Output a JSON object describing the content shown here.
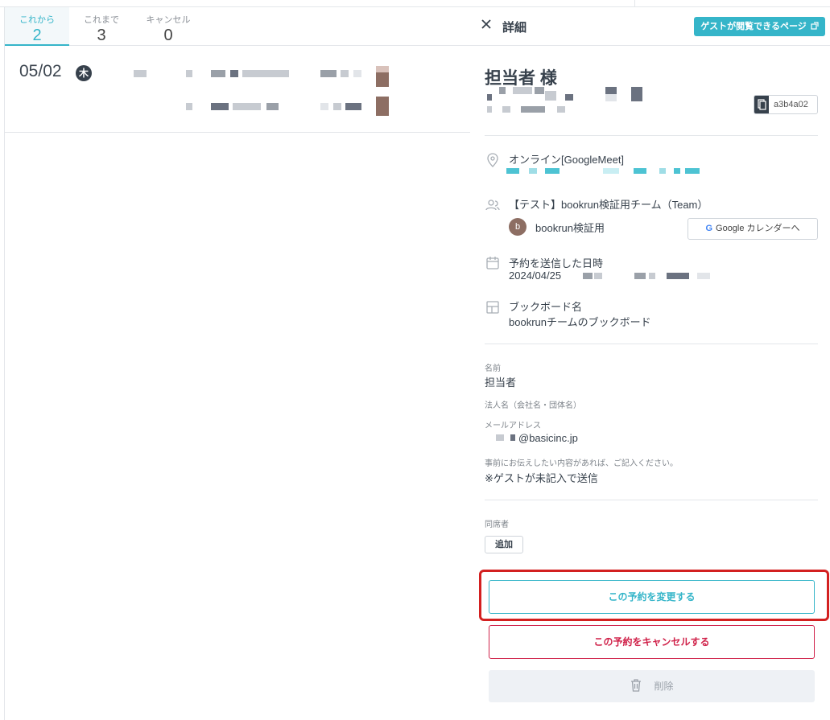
{
  "colors": {
    "accent": "#35b5c9",
    "danger": "#d0224a",
    "dark": "#37414c",
    "highlight": "#d32020"
  },
  "tabs": [
    {
      "label": "これから",
      "count": "2"
    },
    {
      "label": "これまで",
      "count": "3"
    },
    {
      "label": "キャンセル",
      "count": "0"
    }
  ],
  "list": {
    "date": "05/02",
    "weekday": "木"
  },
  "detail": {
    "header_title": "詳細",
    "guest_page_button": "ゲストが閲覧できるページ",
    "name_title": "担当者 様",
    "booking_id": "a3b4a02",
    "location_label": "オンライン[GoogleMeet]",
    "team_label": "【テスト】bookrun検証用チーム（Team）",
    "member_initial": "b",
    "member_name": "bookrun検証用",
    "gcal_button": "Google カレンダーへ",
    "sent_label": "予約を送信した日時",
    "sent_value": "2024/04/25",
    "board_label": "ブックボード名",
    "board_value": "bookrunチームのブックボード"
  },
  "form": {
    "name_label": "名前",
    "name_value": "担当者",
    "company_label": "法人名（会社名・団体名）",
    "email_label": "メールアドレス",
    "email_value": "@basicinc.jp",
    "message_label": "事前にお伝えしたい内容があれば、ご記入ください。",
    "message_value": "※ゲストが未記入で送信"
  },
  "attendees": {
    "label": "同席者",
    "add_button": "追加"
  },
  "actions": {
    "change_button": "この予約を変更する",
    "cancel_button": "この予約をキャンセルする",
    "delete_button": "削除"
  }
}
